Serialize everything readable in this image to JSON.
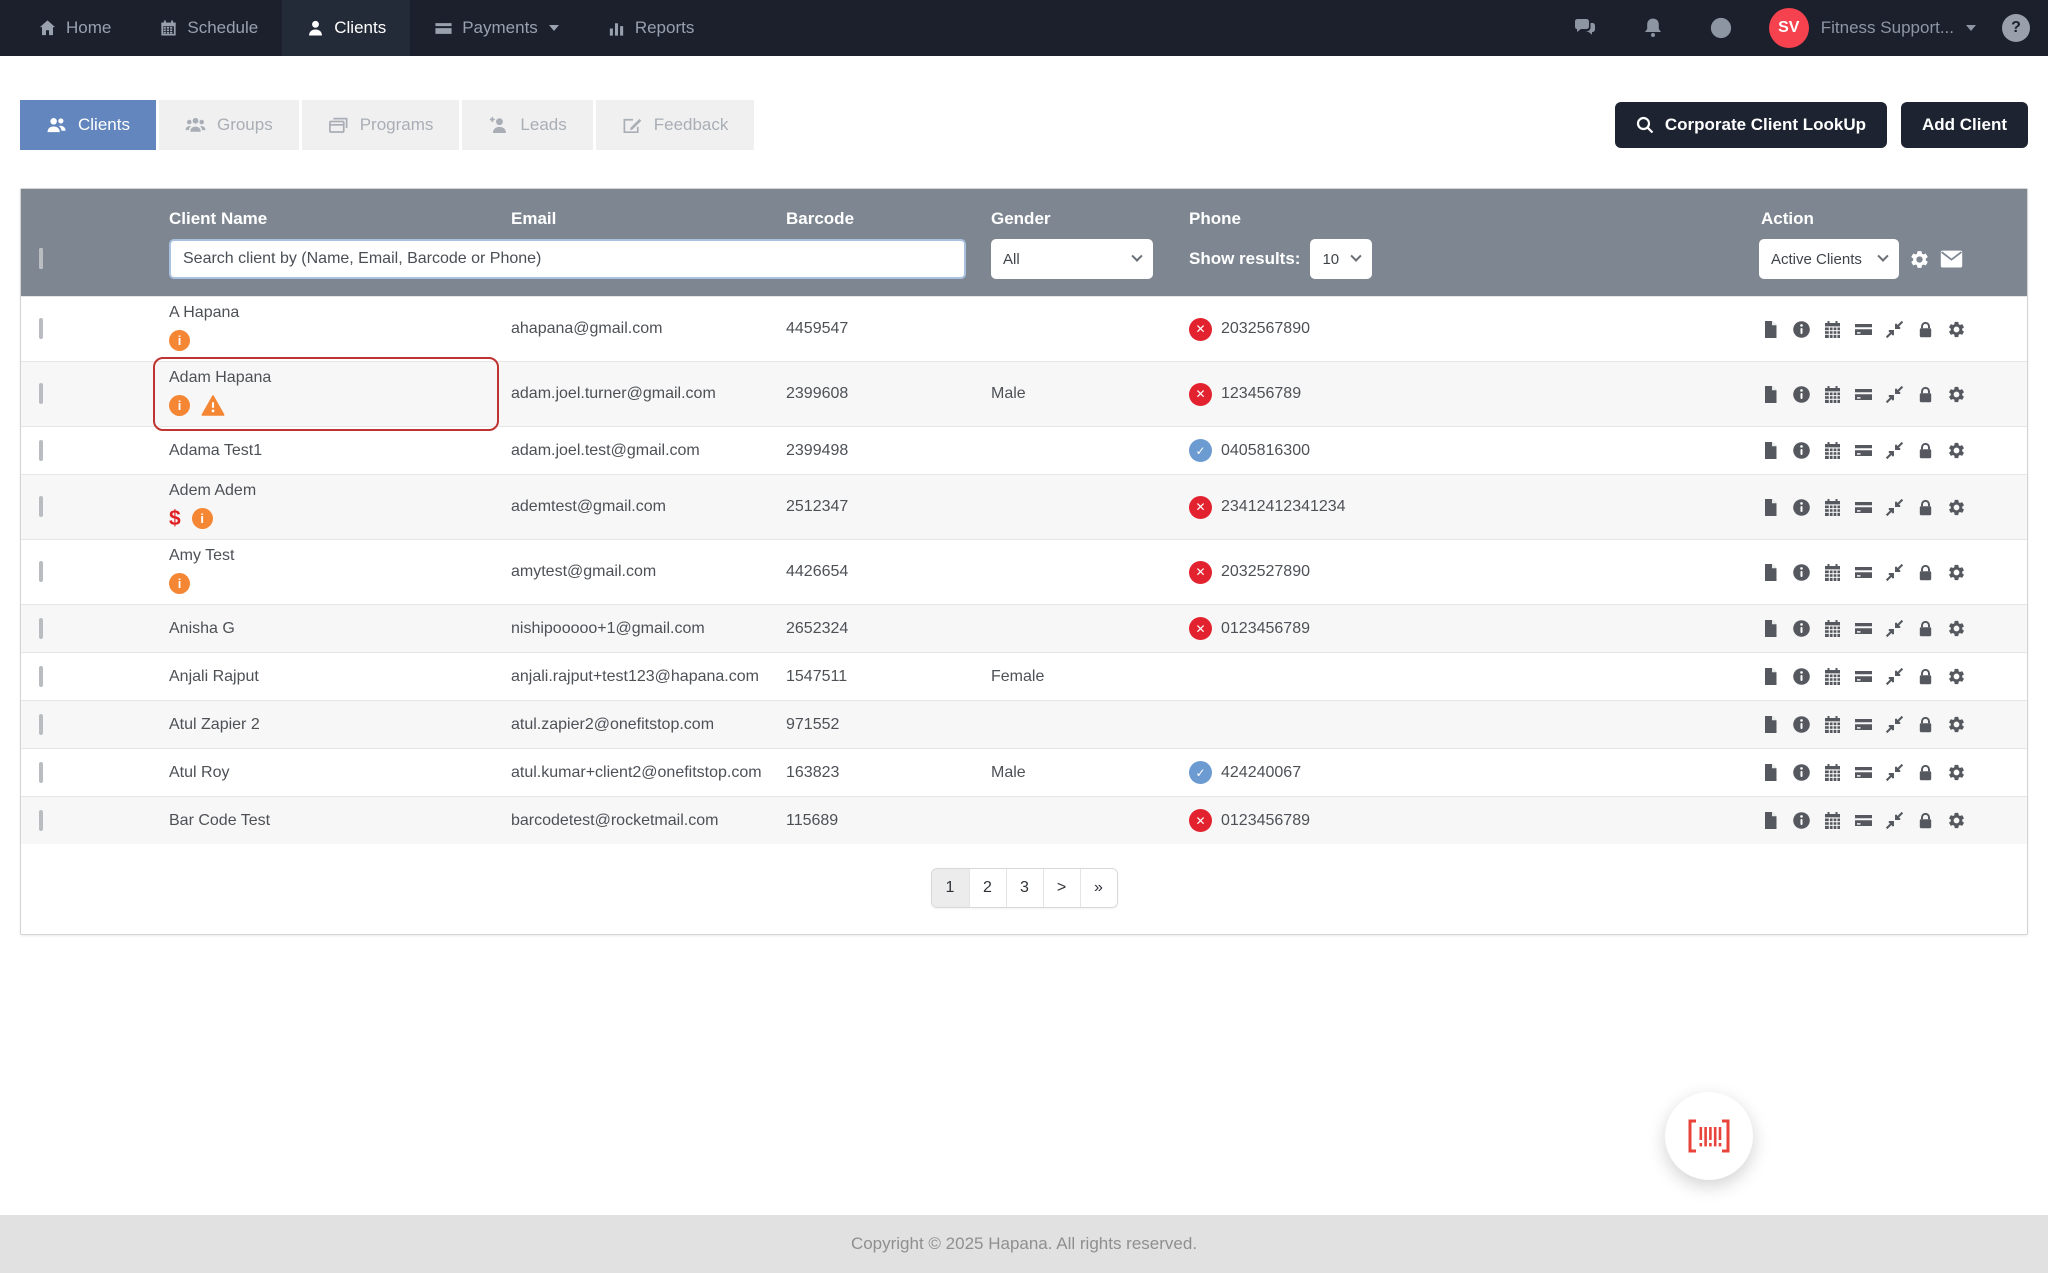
{
  "nav": {
    "items": [
      {
        "label": "Home",
        "icon": "home-icon",
        "active": false
      },
      {
        "label": "Schedule",
        "icon": "calendar-icon",
        "active": false
      },
      {
        "label": "Clients",
        "icon": "person-icon",
        "active": true
      },
      {
        "label": "Payments",
        "icon": "credit-card-icon",
        "active": false,
        "has_dropdown": true
      },
      {
        "label": "Reports",
        "icon": "bar-chart-icon",
        "active": false
      }
    ],
    "account": {
      "initials": "SV",
      "name": "Fitness Support..."
    }
  },
  "tabs": [
    {
      "label": "Clients",
      "icon": "clients-icon",
      "active": true
    },
    {
      "label": "Groups",
      "icon": "groups-icon",
      "active": false
    },
    {
      "label": "Programs",
      "icon": "programs-icon",
      "active": false
    },
    {
      "label": "Leads",
      "icon": "leads-icon",
      "active": false
    },
    {
      "label": "Feedback",
      "icon": "feedback-icon",
      "active": false
    }
  ],
  "actions": {
    "corporate_lookup": "Corporate Client LookUp",
    "add_client": "Add Client"
  },
  "table": {
    "columns": [
      "Client Name",
      "Email",
      "Barcode",
      "Gender",
      "Phone",
      "Action"
    ],
    "search_placeholder": "Search client by (Name, Email, Barcode or Phone)",
    "gender_filter": "All",
    "show_results_label": "Show results:",
    "show_results_value": "10",
    "status_filter": "Active Clients",
    "action_icons": [
      "document-icon",
      "info-circle-icon",
      "calendar-icon",
      "credit-card-icon",
      "compress-icon",
      "lock-icon",
      "gear-icon"
    ],
    "rows": [
      {
        "name": "A Hapana",
        "badges": [
          "info"
        ],
        "email": "ahapana@gmail.com",
        "barcode": "4459547",
        "gender": "",
        "phone": "2032567890",
        "phone_status": "invalid",
        "highlighted": false
      },
      {
        "name": "Adam Hapana",
        "badges": [
          "info",
          "warning"
        ],
        "email": "adam.joel.turner@gmail.com",
        "barcode": "2399608",
        "gender": "Male",
        "phone": "123456789",
        "phone_status": "invalid",
        "highlighted": true
      },
      {
        "name": "Adama Test1",
        "badges": [],
        "email": "adam.joel.test@gmail.com",
        "barcode": "2399498",
        "gender": "",
        "phone": "0405816300",
        "phone_status": "verified",
        "highlighted": false
      },
      {
        "name": "Adem Adem",
        "badges": [
          "dollar",
          "info"
        ],
        "email": "ademtest@gmail.com",
        "barcode": "2512347",
        "gender": "",
        "phone": "23412412341234",
        "phone_status": "invalid",
        "highlighted": false
      },
      {
        "name": "Amy Test",
        "badges": [
          "info"
        ],
        "email": "amytest@gmail.com",
        "barcode": "4426654",
        "gender": "",
        "phone": "2032527890",
        "phone_status": "invalid",
        "highlighted": false
      },
      {
        "name": "Anisha G",
        "badges": [],
        "email": "nishipooooo+1@gmail.com",
        "barcode": "2652324",
        "gender": "",
        "phone": "0123456789",
        "phone_status": "invalid",
        "highlighted": false
      },
      {
        "name": "Anjali Rajput",
        "badges": [],
        "email": "anjali.rajput+test123@hapana.com",
        "barcode": "1547511",
        "gender": "Female",
        "phone": "",
        "phone_status": "",
        "highlighted": false
      },
      {
        "name": "Atul Zapier 2",
        "badges": [],
        "email": "atul.zapier2@onefitstop.com",
        "barcode": "971552",
        "gender": "",
        "phone": "",
        "phone_status": "",
        "highlighted": false
      },
      {
        "name": "Atul Roy",
        "badges": [],
        "email": "atul.kumar+client2@onefitstop.com",
        "barcode": "163823",
        "gender": "Male",
        "phone": "424240067",
        "phone_status": "verified",
        "highlighted": false
      },
      {
        "name": "Bar Code Test",
        "badges": [],
        "email": "barcodetest@rocketmail.com",
        "barcode": "115689",
        "gender": "",
        "phone": "0123456789",
        "phone_status": "invalid",
        "highlighted": false
      }
    ]
  },
  "pagination": {
    "pages": [
      "1",
      "2",
      "3",
      ">",
      "»"
    ],
    "active_index": 0
  },
  "footer": {
    "text": "Copyright © 2025 Hapana. All rights reserved."
  },
  "colors": {
    "nav_bg": "#1b202c",
    "tab_active": "#6286bd",
    "table_header": "#7e8791",
    "avatar": "#f6424e",
    "phone_invalid": "#e3222f",
    "phone_verified": "#6c9bd2",
    "badge_orange": "#f58634",
    "dollar_red": "#e01f23",
    "highlight_border": "#bf3430",
    "fab_barcode": "#e8443b",
    "button_bg": "#1d2330"
  }
}
